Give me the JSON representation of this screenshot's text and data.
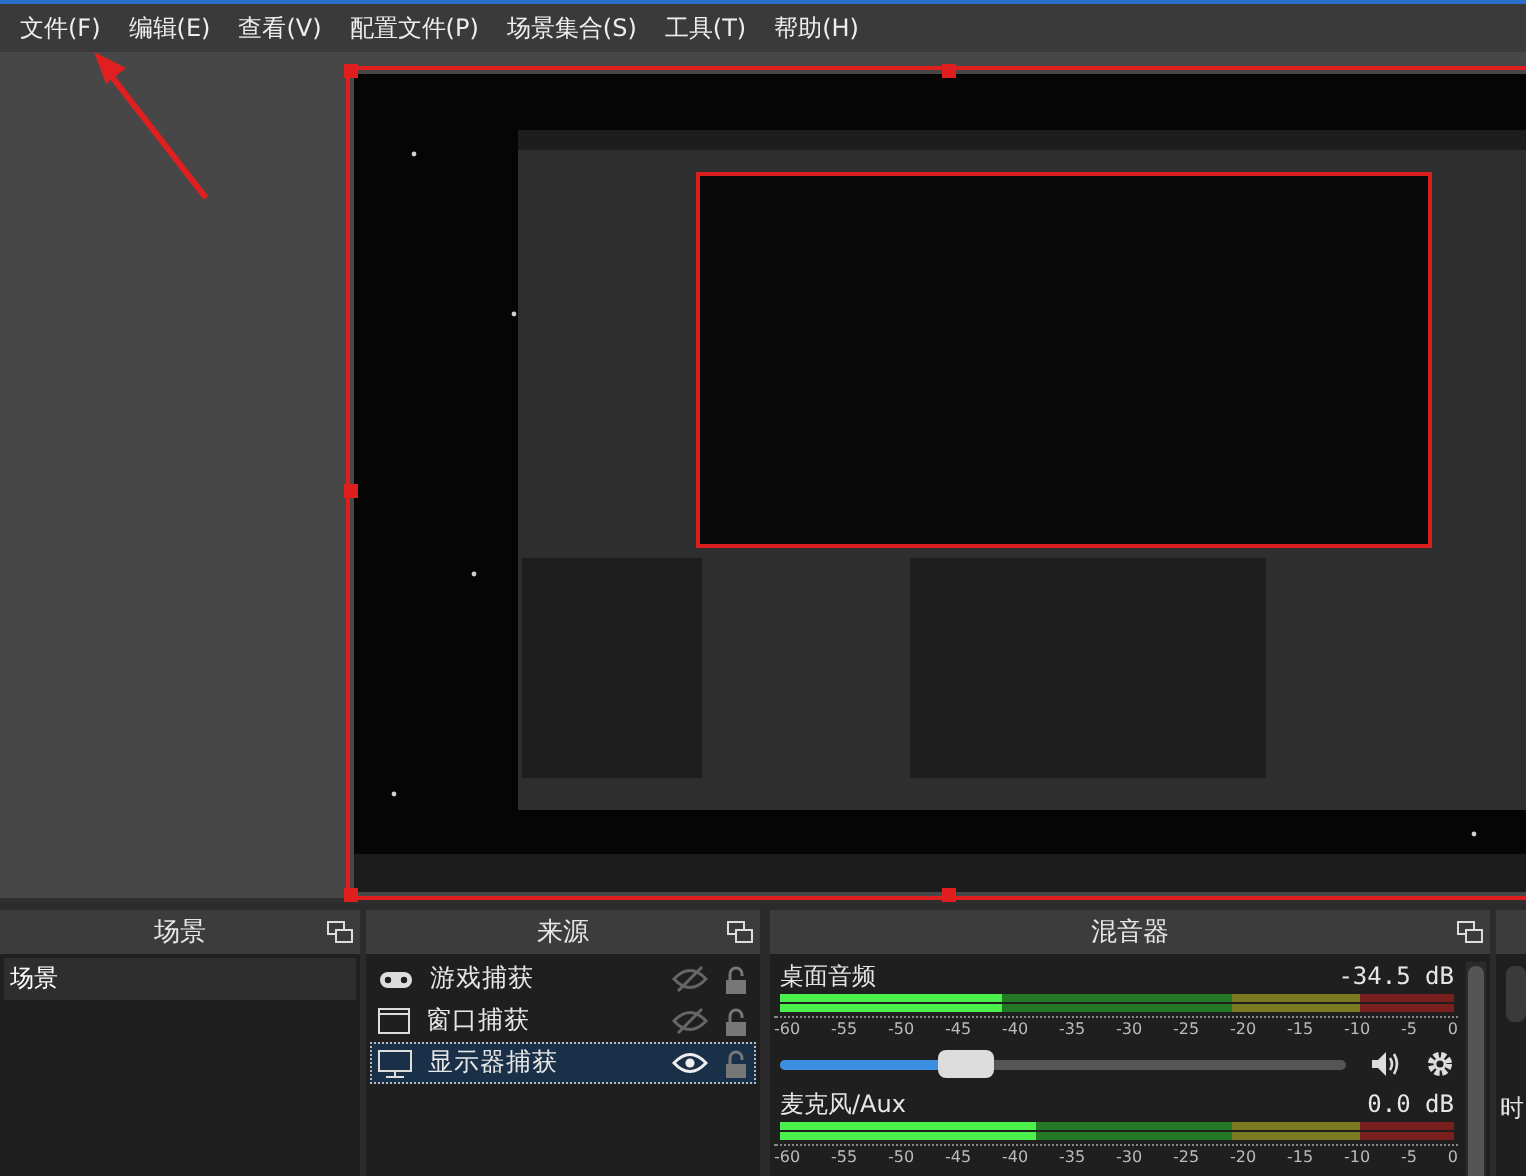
{
  "menu": [
    "文件(F)",
    "编辑(E)",
    "查看(V)",
    "配置文件(P)",
    "场景集合(S)",
    "工具(T)",
    "帮助(H)"
  ],
  "scenes": {
    "title": "场景",
    "items": [
      {
        "label": "场景",
        "selected": true
      }
    ]
  },
  "sources": {
    "title": "来源",
    "items": [
      {
        "label": "游戏捕获",
        "kind": "gamepad",
        "visible": false,
        "locked": false,
        "selected": false
      },
      {
        "label": "窗口捕获",
        "kind": "window",
        "visible": false,
        "locked": false,
        "selected": false
      },
      {
        "label": "显示器捕获",
        "kind": "monitor",
        "visible": true,
        "locked": false,
        "selected": true
      }
    ]
  },
  "mixer": {
    "title": "混音器",
    "channels": [
      {
        "name": "桌面音频",
        "reading": "-34.5 dB",
        "meter": {
          "level": 0.33
        },
        "slider": {
          "level": 0.33
        },
        "ticks": [
          "-60",
          "-55",
          "-50",
          "-45",
          "-40",
          "-35",
          "-30",
          "-25",
          "-20",
          "-15",
          "-10",
          "-5",
          "0"
        ]
      },
      {
        "name": "麦克风/Aux",
        "reading": "0.0 dB",
        "meter": {
          "level": 0.38
        },
        "ticks": [
          "-60",
          "-55",
          "-50",
          "-45",
          "-40",
          "-35",
          "-30",
          "-25",
          "-20",
          "-15",
          "-10",
          "-5",
          "0"
        ]
      }
    ]
  },
  "partial_dock": {
    "label": "时"
  }
}
